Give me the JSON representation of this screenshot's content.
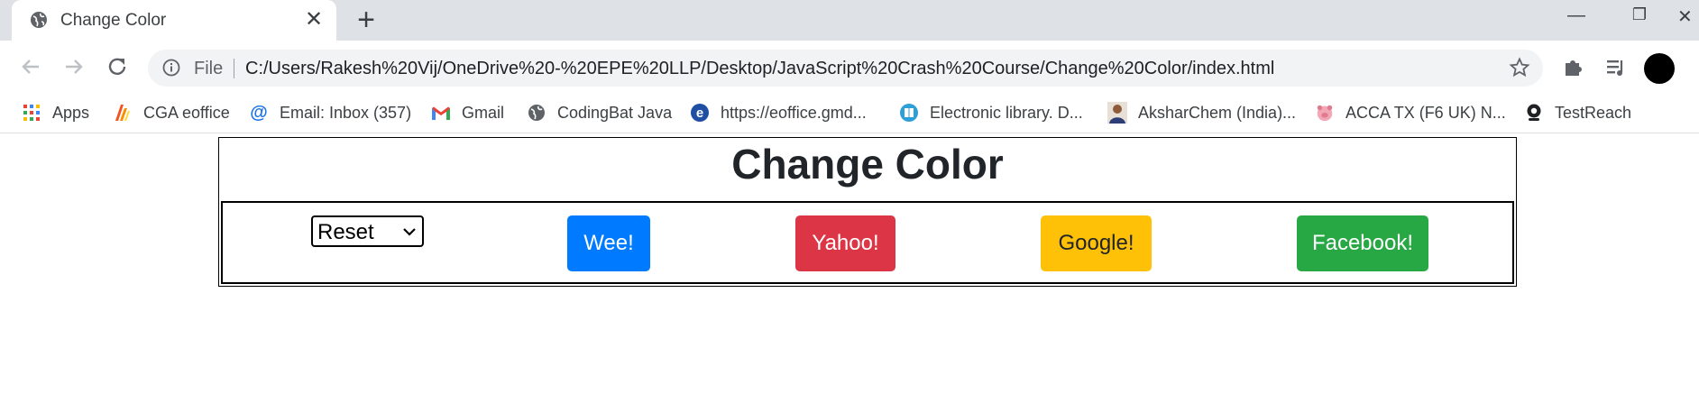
{
  "browser": {
    "tab_title": "Change Color",
    "url_scheme_label": "File",
    "url": "C:/Users/Rakesh%20Vij/OneDrive%20-%20EPE%20LLP/Desktop/JavaScript%20Crash%20Course/Change%20Color/index.html",
    "bookmarks": [
      {
        "label": "Apps",
        "icon": "apps-grid-icon"
      },
      {
        "label": "CGA eoffice",
        "icon": "cga-logo-icon"
      },
      {
        "label": "Email: Inbox (357)",
        "icon": "at-sign-icon"
      },
      {
        "label": "Gmail",
        "icon": "gmail-icon"
      },
      {
        "label": "CodingBat Java",
        "icon": "globe-icon"
      },
      {
        "label": "https://eoffice.gmd...",
        "icon": "e-logo-icon"
      },
      {
        "label": "Electronic library. D...",
        "icon": "book-icon"
      },
      {
        "label": "AksharChem (India)...",
        "icon": "person-icon"
      },
      {
        "label": "ACCA TX (F6 UK) N...",
        "icon": "pig-icon"
      },
      {
        "label": "TestReach",
        "icon": "webcam-icon"
      }
    ]
  },
  "page": {
    "title": "Change Color",
    "select": {
      "value": "Reset"
    },
    "buttons": [
      {
        "label": "Wee!",
        "color": "#007bff"
      },
      {
        "label": "Yahoo!",
        "color": "#dc3545"
      },
      {
        "label": "Google!",
        "color": "#ffc107"
      },
      {
        "label": "Facebook!",
        "color": "#28a745"
      }
    ]
  }
}
